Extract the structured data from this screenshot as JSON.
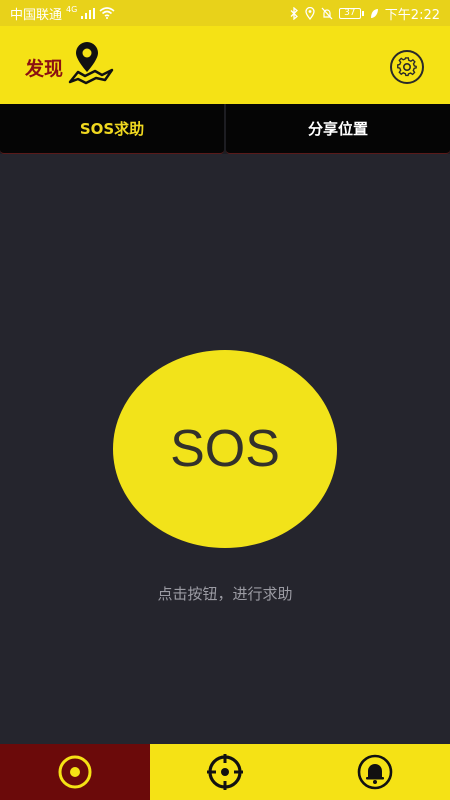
{
  "status_bar": {
    "carrier": "中国联通",
    "network": "4G",
    "battery": "37",
    "time": "下午2:22"
  },
  "header": {
    "title": "发现",
    "logo_icon": "map-pin-icon",
    "settings_icon": "gear-icon"
  },
  "tabs": [
    {
      "label": "SOS求助",
      "active": true
    },
    {
      "label": "分享位置",
      "active": false
    }
  ],
  "sos": {
    "button_label": "SOS",
    "hint": "点击按钮，进行求助"
  },
  "bottom_nav": [
    {
      "icon": "eye-icon",
      "active": true
    },
    {
      "icon": "crosshair-icon",
      "active": false
    },
    {
      "icon": "bell-icon",
      "active": false
    }
  ],
  "colors": {
    "accent_yellow": "#f5e215",
    "dark_red": "#6b0a0a",
    "background": "#25252d"
  }
}
